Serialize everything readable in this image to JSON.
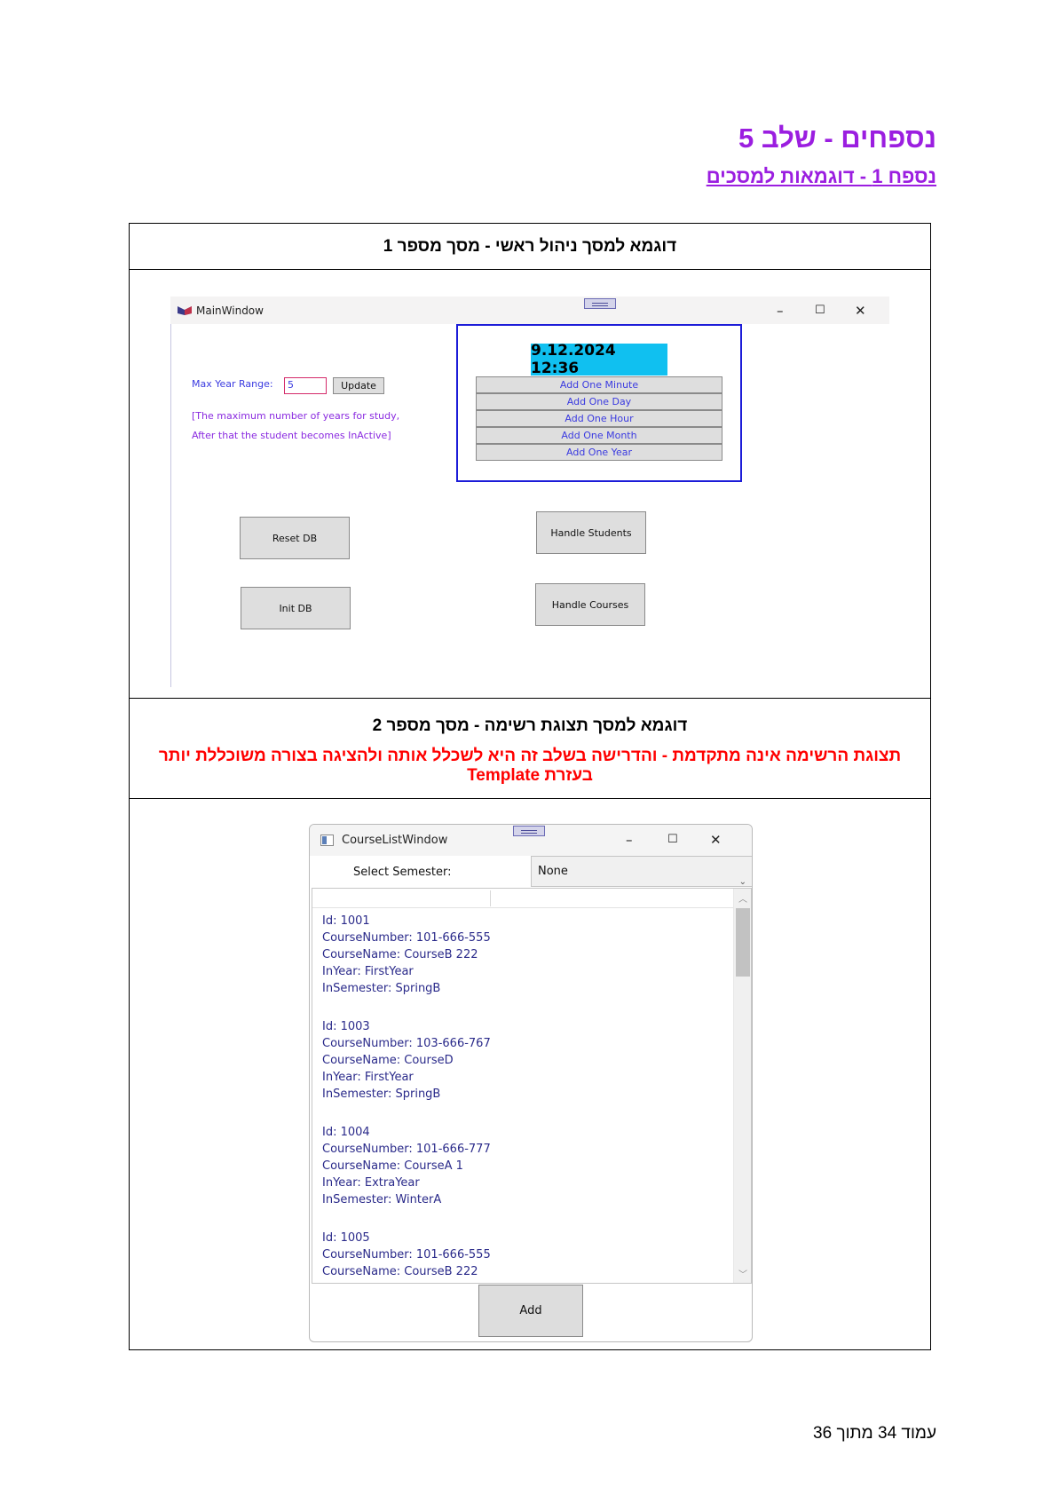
{
  "header": {
    "title": "נספחים - שלב 5",
    "subtitle": "נספח 1 - דוגמאות למסכים"
  },
  "table": {
    "caption1": "דוגמא למסך ניהול ראשי - מסך מספר 1",
    "caption2": "דוגמא למסך תצוגת רשימה - מסך מספר 2",
    "note2": "תצוגת הרשימה אינה מתקדמת - והדרישה בשלב זה היא לשכלל אותה ולהציגה בצורה משוכללת יותר בעזרת Template"
  },
  "main_window": {
    "title": "MainWindow",
    "controls": {
      "minimize": "–",
      "maximize": "☐",
      "close": "✕"
    },
    "max_year_label": "Max Year Range:",
    "max_year_value": "5",
    "update_button": "Update",
    "hint_line1": "[The maximum number of years for study,",
    "hint_line2": "After that the student becomes InActive]",
    "clock": "9.12.2024 12:36",
    "add_buttons": [
      "Add One Minute",
      "Add One Day",
      "Add One Hour",
      "Add One Month",
      "Add One Year"
    ],
    "reset_db": "Reset DB",
    "init_db": "Init DB",
    "handle_students": "Handle Students",
    "handle_courses": "Handle Courses",
    "colors": {
      "accent": "#1c1cd8",
      "clock_bg": "#10c0f0",
      "label": "#3a3ae0",
      "hint": "#8a2ae0"
    }
  },
  "course_window": {
    "title": "CourseListWindow",
    "controls": {
      "minimize": "–",
      "maximize": "☐",
      "close": "✕"
    },
    "select_label": "Select Semester:",
    "semester_value": "None",
    "courses": [
      {
        "id": "Id: 1001",
        "number": "CourseNumber: 101-666-555",
        "name": "CourseName: CourseB 222",
        "year": "InYear: FirstYear",
        "semester": "InSemester: SpringB"
      },
      {
        "id": "Id: 1003",
        "number": "CourseNumber: 103-666-767",
        "name": "CourseName: CourseD",
        "year": "InYear: FirstYear",
        "semester": "InSemester: SpringB"
      },
      {
        "id": "Id: 1004",
        "number": "CourseNumber: 101-666-777",
        "name": "CourseName: CourseA 1",
        "year": "InYear: ExtraYear",
        "semester": "InSemester: WinterA"
      },
      {
        "id": "Id: 1005",
        "number": "CourseNumber: 101-666-555",
        "name": "CourseName: CourseB 222"
      }
    ],
    "add_button": "Add"
  },
  "footer": {
    "page_text": "עמוד 34 מתוך 36"
  },
  "icons": [
    "app-icon",
    "window-icon",
    "drag-grip-icon",
    "chevron-down-icon",
    "scroll-up-icon",
    "scroll-down-icon"
  ]
}
